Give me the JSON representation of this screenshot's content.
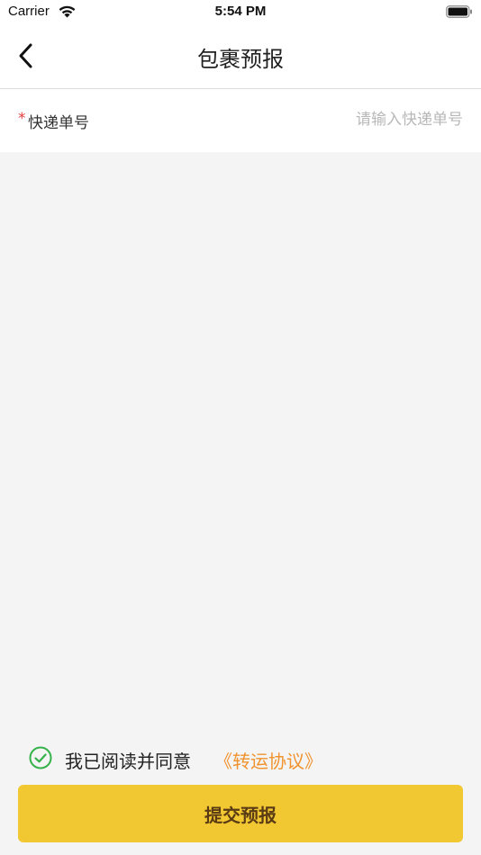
{
  "status_bar": {
    "carrier": "Carrier",
    "time": "5:54 PM",
    "wifi_icon": "wifi-icon",
    "battery_icon": "battery-full-icon"
  },
  "nav": {
    "title": "包裹预报",
    "back_icon": "chevron-left-icon"
  },
  "form": {
    "required_mark": "*",
    "tracking_label": "快递单号",
    "tracking_placeholder": "请输入快递单号",
    "tracking_value": ""
  },
  "agreement": {
    "checked": true,
    "check_icon": "check-circle-icon",
    "text": "我已阅读并同意",
    "link": "《转运协议》"
  },
  "submit": {
    "label": "提交预报"
  },
  "colors": {
    "accent": "#f2c832",
    "link": "#f0932e",
    "required": "#e23c3c",
    "check": "#36b24a",
    "background": "#f4f4f4"
  }
}
